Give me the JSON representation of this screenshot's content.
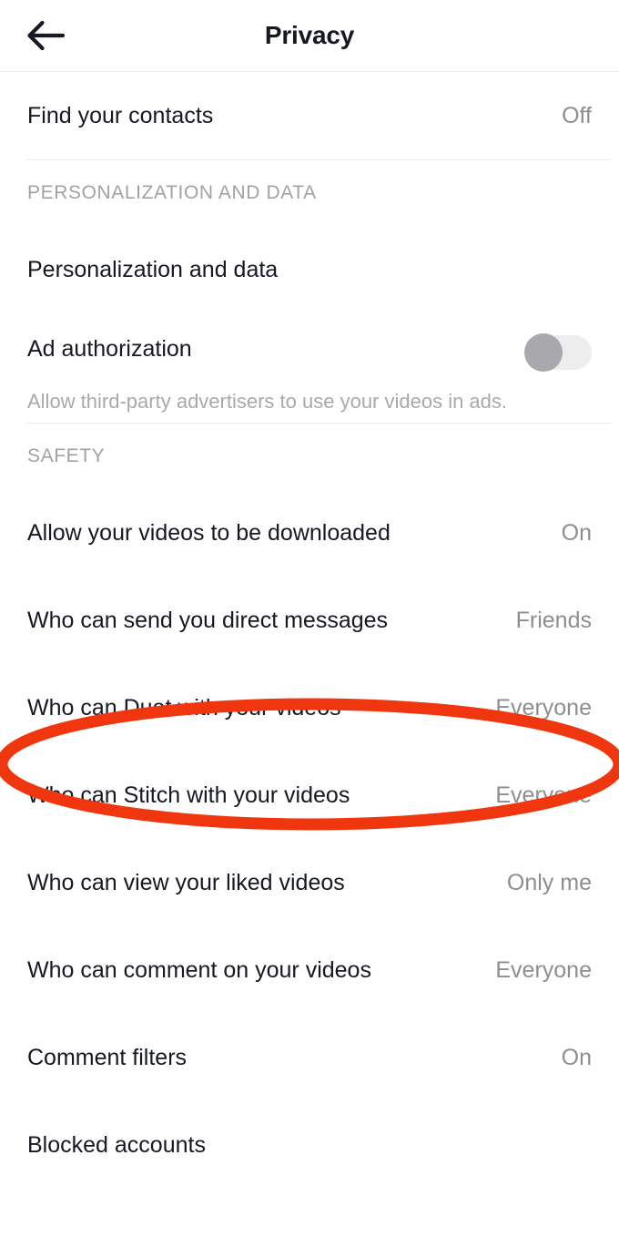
{
  "header": {
    "title": "Privacy",
    "back_icon": "arrow-left-icon"
  },
  "sections": [
    {
      "id": "top",
      "header": null,
      "rows": [
        {
          "id": "find-your-contacts",
          "label": "Find your contacts",
          "value": "Off",
          "control": "value"
        }
      ]
    },
    {
      "id": "personalization-and-data",
      "header": "PERSONALIZATION AND DATA",
      "rows": [
        {
          "id": "personalization-and-data",
          "label": "Personalization and data",
          "value": "",
          "control": "none"
        },
        {
          "id": "ad-authorization",
          "label": "Ad authorization",
          "value": "",
          "control": "toggle",
          "toggle_state": "off",
          "subtitle": "Allow third-party advertisers to use your videos in ads."
        }
      ]
    },
    {
      "id": "safety",
      "header": "SAFETY",
      "rows": [
        {
          "id": "allow-videos-downloaded",
          "label": "Allow your videos to be downloaded",
          "value": "On",
          "control": "value"
        },
        {
          "id": "who-can-send-direct-messages",
          "label": "Who can send you direct messages",
          "value": "Friends",
          "control": "value"
        },
        {
          "id": "who-can-duet",
          "label": "Who can Duet with your videos",
          "value": "Everyone",
          "control": "value",
          "highlighted": true
        },
        {
          "id": "who-can-stitch",
          "label": "Who can Stitch with your videos",
          "value": "Everyone",
          "control": "value"
        },
        {
          "id": "who-can-view-liked-videos",
          "label": "Who can view your liked videos",
          "value": "Only me",
          "control": "value"
        },
        {
          "id": "who-can-comment",
          "label": "Who can comment on your videos",
          "value": "Everyone",
          "control": "value"
        },
        {
          "id": "comment-filters",
          "label": "Comment filters",
          "value": "On",
          "control": "value"
        },
        {
          "id": "blocked-accounts",
          "label": "Blocked accounts",
          "value": "",
          "control": "none"
        }
      ]
    }
  ],
  "annotation": {
    "type": "ellipse",
    "target": "Who can Duet with your videos",
    "color": "#F0360F",
    "stroke_width": 13
  },
  "colors": {
    "background": "#FFFFFF",
    "primary_text": "#161823",
    "secondary_text": "#8D8D92",
    "muted_text": "#A9A9AD",
    "section_header_text": "#A2A2A6",
    "divider": "#EDEDED",
    "annotation_red": "#F0360F",
    "toggle_track_off": "#EDEDEE",
    "toggle_knob_off": "#A8A8AD"
  }
}
